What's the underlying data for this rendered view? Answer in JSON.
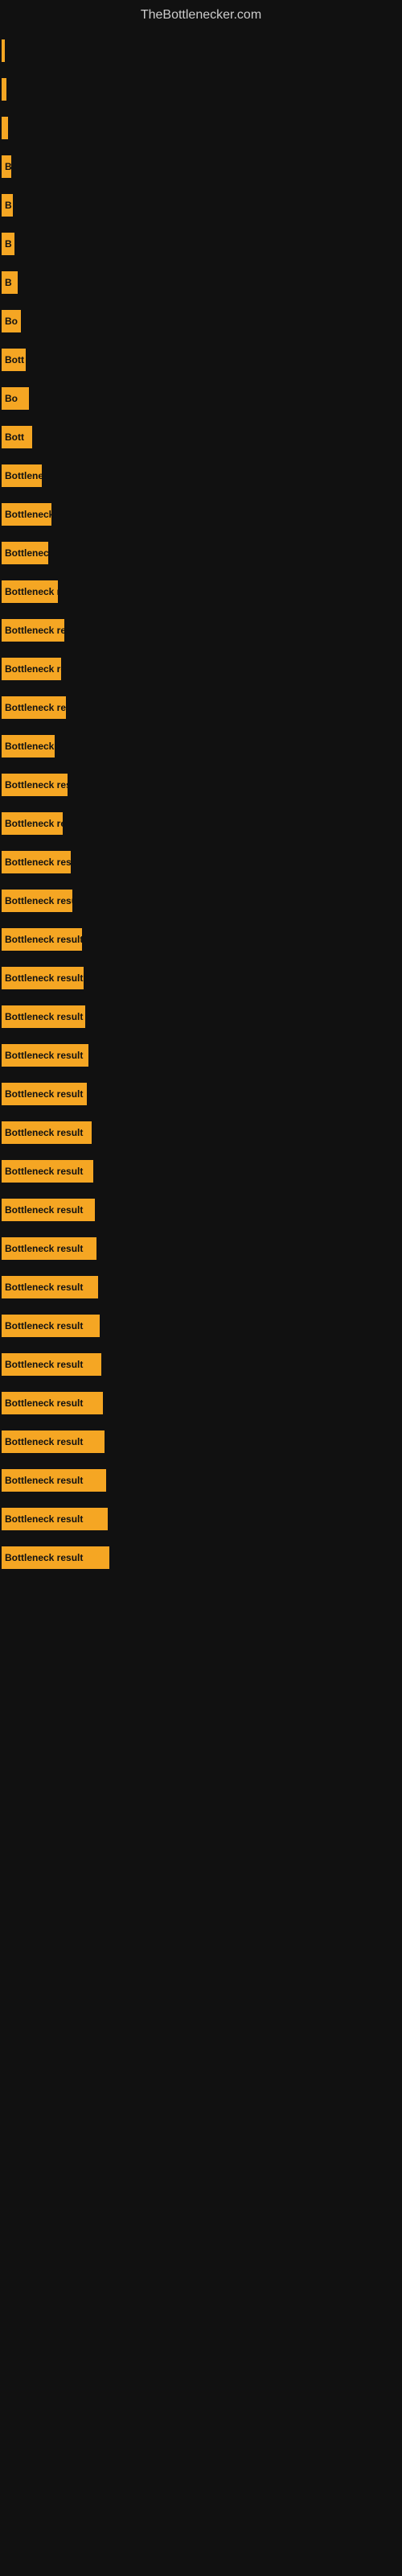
{
  "site": {
    "title": "TheBottlenecker.com"
  },
  "bars": [
    {
      "id": 1,
      "width": 4,
      "label": ""
    },
    {
      "id": 2,
      "width": 6,
      "label": ""
    },
    {
      "id": 3,
      "width": 8,
      "label": ""
    },
    {
      "id": 4,
      "width": 12,
      "label": "B"
    },
    {
      "id": 5,
      "width": 14,
      "label": "B"
    },
    {
      "id": 6,
      "width": 16,
      "label": "B"
    },
    {
      "id": 7,
      "width": 20,
      "label": "B"
    },
    {
      "id": 8,
      "width": 24,
      "label": "Bo"
    },
    {
      "id": 9,
      "width": 30,
      "label": "Bott"
    },
    {
      "id": 10,
      "width": 34,
      "label": "Bo"
    },
    {
      "id": 11,
      "width": 38,
      "label": "Bott"
    },
    {
      "id": 12,
      "width": 50,
      "label": "Bottlene"
    },
    {
      "id": 13,
      "width": 62,
      "label": "Bottleneck re"
    },
    {
      "id": 14,
      "width": 58,
      "label": "Bottleneck"
    },
    {
      "id": 15,
      "width": 70,
      "label": "Bottleneck res"
    },
    {
      "id": 16,
      "width": 78,
      "label": "Bottleneck result"
    },
    {
      "id": 17,
      "width": 74,
      "label": "Bottleneck res"
    },
    {
      "id": 18,
      "width": 80,
      "label": "Bottleneck resul"
    },
    {
      "id": 19,
      "width": 66,
      "label": "Bottleneck re"
    },
    {
      "id": 20,
      "width": 82,
      "label": "Bottleneck result"
    },
    {
      "id": 21,
      "width": 76,
      "label": "Bottleneck resu"
    },
    {
      "id": 22,
      "width": 86,
      "label": "Bottleneck result"
    },
    {
      "id": 23,
      "width": 88,
      "label": "Bottleneck result"
    },
    {
      "id": 24,
      "width": 100,
      "label": "Bottleneck result"
    },
    {
      "id": 25,
      "width": 102,
      "label": "Bottleneck result"
    },
    {
      "id": 26,
      "width": 104,
      "label": "Bottleneck result"
    },
    {
      "id": 27,
      "width": 108,
      "label": "Bottleneck result"
    },
    {
      "id": 28,
      "width": 106,
      "label": "Bottleneck result"
    },
    {
      "id": 29,
      "width": 112,
      "label": "Bottleneck result"
    },
    {
      "id": 30,
      "width": 114,
      "label": "Bottleneck result"
    },
    {
      "id": 31,
      "width": 116,
      "label": "Bottleneck result"
    },
    {
      "id": 32,
      "width": 118,
      "label": "Bottleneck result"
    },
    {
      "id": 33,
      "width": 120,
      "label": "Bottleneck result"
    },
    {
      "id": 34,
      "width": 122,
      "label": "Bottleneck result"
    },
    {
      "id": 35,
      "width": 124,
      "label": "Bottleneck result"
    },
    {
      "id": 36,
      "width": 126,
      "label": "Bottleneck result"
    },
    {
      "id": 37,
      "width": 128,
      "label": "Bottleneck result"
    },
    {
      "id": 38,
      "width": 130,
      "label": "Bottleneck result"
    },
    {
      "id": 39,
      "width": 132,
      "label": "Bottleneck result"
    },
    {
      "id": 40,
      "width": 134,
      "label": "Bottleneck result"
    }
  ]
}
